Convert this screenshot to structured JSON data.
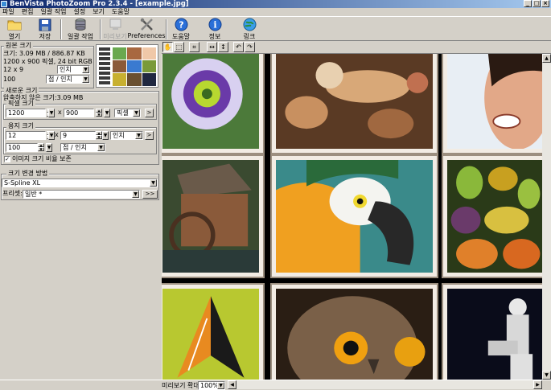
{
  "window": {
    "title": "BenVista PhotoZoom Pro 2.3.4 - [example.jpg]"
  },
  "menu": [
    "파일",
    "편집",
    "일괄 작업",
    "설정",
    "보기",
    "도움말"
  ],
  "toolbar": {
    "open": "열기",
    "save": "저장",
    "batch": "일괄 작업",
    "preview": "미리보기",
    "preferences": "Preferences",
    "help": "도움말",
    "info": "정보",
    "link": "링크"
  },
  "original": {
    "title": "원본 크기",
    "size": "크기: 3.09 MB / 886.87 KB",
    "dims": "1200 x 900 픽셀, 24 bit RGB",
    "print_size": "12 x 9",
    "print_unit": "인치",
    "resolution": "100",
    "res_unit": "점 / 인치"
  },
  "newsize": {
    "title": "새로운 크기",
    "uncompressed": "압축하지 않은 크기:3.09 MB",
    "pixel_title": "픽셀 크기",
    "width_px": "1200",
    "height_px": "900",
    "px_unit": "픽셀",
    "paper_title": "용지 크기",
    "width_in": "12",
    "height_in": "9",
    "in_unit": "인치",
    "resolution": "100",
    "res_unit": "점 / 인치",
    "keep_ratio": "이미지 크기 비율 보존",
    "x_label": "x",
    "more": ">"
  },
  "method": {
    "title": "크기 변경 방법",
    "value": "S-Spline XL",
    "preset_label": "프리셋:",
    "preset_value": "일반 *",
    "more": ">>"
  },
  "status": {
    "zoom_label": "미리보기 확대:",
    "zoom_value": "100%"
  },
  "icons": {
    "open": "folder-icon",
    "save": "floppy-icon",
    "batch": "batch-stack-icon",
    "preview": "monitor-icon",
    "preferences": "tools-icon",
    "help": "help-icon",
    "info": "info-icon",
    "link": "globe-icon",
    "view_tools": [
      "hand-icon",
      "zoom-rect-icon",
      "crop-icon",
      "fit-width-icon",
      "fit-height-icon",
      "rotate-left-icon",
      "rotate-right-icon"
    ]
  },
  "colors": {
    "titlebar_start": "#0a246a",
    "titlebar_end": "#a6caf0",
    "chrome": "#d4d0c8",
    "canvas": "#000000",
    "photo_frame": "#f2ece4"
  }
}
